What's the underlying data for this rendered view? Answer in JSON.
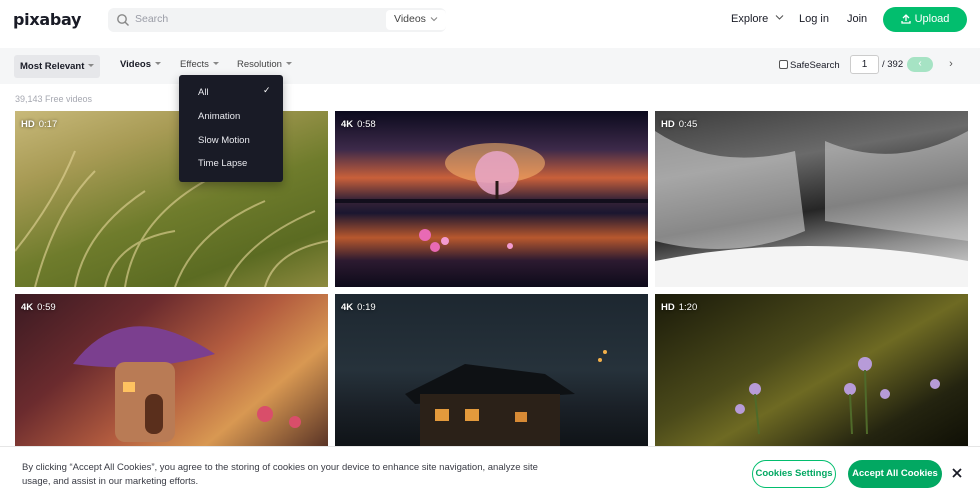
{
  "header": {
    "logo": "pixabay",
    "search_placeholder": "Search",
    "search_type": "Videos",
    "explore": "Explore",
    "login": "Log in",
    "join": "Join",
    "upload": "Upload"
  },
  "filters": {
    "sort": "Most Relevant",
    "media": "Videos",
    "effects": "Effects",
    "resolution": "Resolution",
    "safesearch": "SafeSearch",
    "page_current": "1",
    "page_total": "/ 392",
    "prev": "‹",
    "next": "›"
  },
  "effects_menu": {
    "items": [
      "All",
      "Animation",
      "Slow Motion",
      "Time Lapse"
    ],
    "selected_check": "✓"
  },
  "results": {
    "count": "39,143 Free videos",
    "videos": [
      {
        "quality": "HD",
        "duration": "0:17"
      },
      {
        "quality": "4K",
        "duration": "0:58"
      },
      {
        "quality": "HD",
        "duration": "0:45"
      },
      {
        "quality": "4K",
        "duration": "0:59"
      },
      {
        "quality": "4K",
        "duration": "0:19"
      },
      {
        "quality": "HD",
        "duration": "1:20"
      }
    ]
  },
  "cookie_banner": {
    "text": "By clicking “Accept All Cookies”, you agree to the storing of cookies on your device to enhance site navigation, analyze site usage, and assist in our marketing efforts.",
    "settings": "Cookies Settings",
    "accept": "Accept All Cookies"
  },
  "colors": {
    "brand_green": "#02be6e",
    "dark": "#191b26"
  }
}
